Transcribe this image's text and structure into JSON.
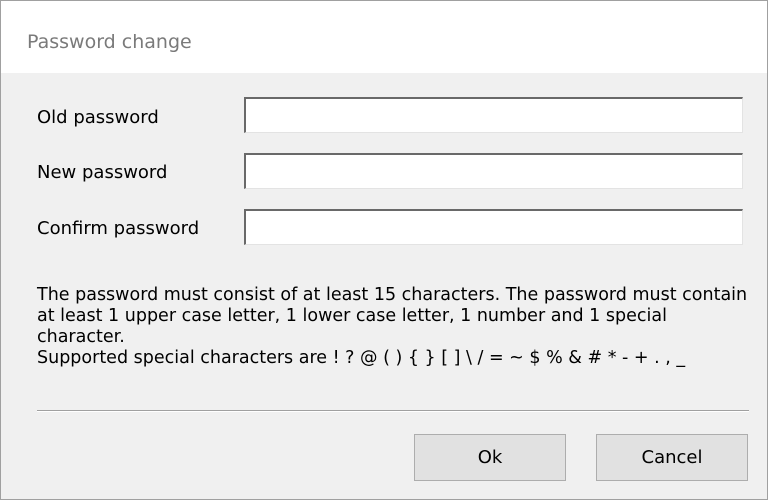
{
  "window": {
    "title": "Password change"
  },
  "form": {
    "fields": [
      {
        "label": "Old password",
        "value": "",
        "placeholder": ""
      },
      {
        "label": "New password",
        "value": "",
        "placeholder": ""
      },
      {
        "label": "Confirm password",
        "value": "",
        "placeholder": ""
      }
    ]
  },
  "info": {
    "requirements": "The password must consist of at least 15 characters. The password must contain at least 1 upper case letter, 1 lower case letter, 1 number and 1 special character.",
    "special_characters": "Supported special characters are ! ? @ ( ) { } [ ] \\ / = ~ $ % & # * - + . , _"
  },
  "buttons": {
    "ok_label": "Ok",
    "cancel_label": "Cancel"
  }
}
